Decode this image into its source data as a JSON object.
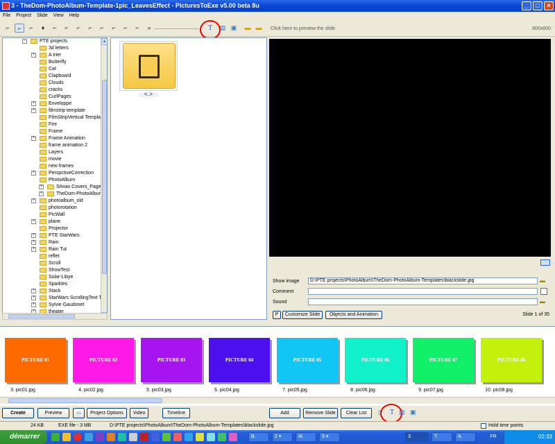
{
  "window": {
    "title": "3 - TheDom-PhotoAlbum-Template-1pic_LeavesEffect - PicturesToExe v5.00 beta 8u"
  },
  "menu": [
    "File",
    "Project",
    "Slide",
    "View",
    "Help"
  ],
  "toolbar": {
    "more": "»"
  },
  "tree": {
    "root": "PTE projects",
    "items": [
      "3d letters",
      "A trier",
      "Butterfly",
      "Cat",
      "Clapboard",
      "Clouds",
      "cracks",
      "CurlPages",
      "Enveloppe",
      "filmstrip template",
      "FilmStripVertical Template",
      "Fire",
      "Frame",
      "Frame Animation",
      "frame animation 2",
      "Layers",
      "movie",
      "new frames",
      "PerspctiveCorrection",
      "PhotoAlbum",
      "Silvias Covers_Pages",
      "TheDom-PhotoAlbum-",
      "photoalbum_old",
      "photorotation",
      "PicWall",
      "plane",
      "Projector",
      "PTE StarWars",
      "Rain",
      "Rain Tut",
      "reflet",
      "Scroll",
      "ShowTest",
      "Solar-Libye",
      "Sparkles",
      "Stack",
      "StarWars ScrollingText Tu",
      "Sylvie Gaudonet",
      "theater"
    ]
  },
  "filelist": {
    "up_label": "<..>"
  },
  "preview": {
    "hint": "Click here to preview the slide",
    "resolution": "800x600"
  },
  "props": {
    "show_image_label": "Show image",
    "show_image_value": "D:\\PTE projects\\PhotoAlbum\\TheDom-PhotoAlbum-Templates\\blackslide.jpg",
    "comment_label": "Comment",
    "comment_value": "",
    "sound_label": "Sound",
    "sound_value": "",
    "p_button": "P",
    "customize_button": "Customize Slide",
    "objects_button": "Objects and Animation",
    "slide_counter": "Slide 1 of 35"
  },
  "slides": [
    {
      "label": "PICTURE 01",
      "caption": "3. pic01.jpg",
      "color": "#ff6a00"
    },
    {
      "label": "PICTURE 02",
      "caption": "4. pic02.jpg",
      "color": "#ff19e8"
    },
    {
      "label": "PICTURE 03",
      "caption": "5. pic03.jpg",
      "color": "#a614ef"
    },
    {
      "label": "PICTURE 04",
      "caption": "6. pic04.jpg",
      "color": "#4c10ef"
    },
    {
      "label": "PICTURE 05",
      "caption": "7. pic05.jpg",
      "color": "#10c6f5"
    },
    {
      "label": "PICTURE 06",
      "caption": "8. pic06.jpg",
      "color": "#12f2ca"
    },
    {
      "label": "PICTURE 07",
      "caption": "9. pic07.jpg",
      "color": "#12f06a"
    },
    {
      "label": "PICTURE 08",
      "caption": "10. pic08.jpg",
      "color": "#c2f20c"
    }
  ],
  "bottom": {
    "create": "Create",
    "preview": "Preview",
    "project_options": "Project Options",
    "video": "Video",
    "timeline": "Timeline",
    "add": "Add",
    "remove": "Remove Slide",
    "clear": "Clear List"
  },
  "status": {
    "size": "24 KB",
    "type": "EXE file - 3 MB",
    "path": "D:\\PTE projects\\PhotoAlbum\\TheDom-PhotoAlbum-Templates\\blackslide.jpg",
    "hold": "Hold time points"
  },
  "taskbar": {
    "start": "démarrer",
    "clock": "02:33",
    "lang": "FR",
    "tasks": [
      "B.",
      "2 ▾",
      "M.",
      "5 ▾",
      "3.",
      "T.",
      "A."
    ]
  },
  "colors": {
    "accent_ring": "#e00000",
    "titlebar": "#0a48d8"
  }
}
